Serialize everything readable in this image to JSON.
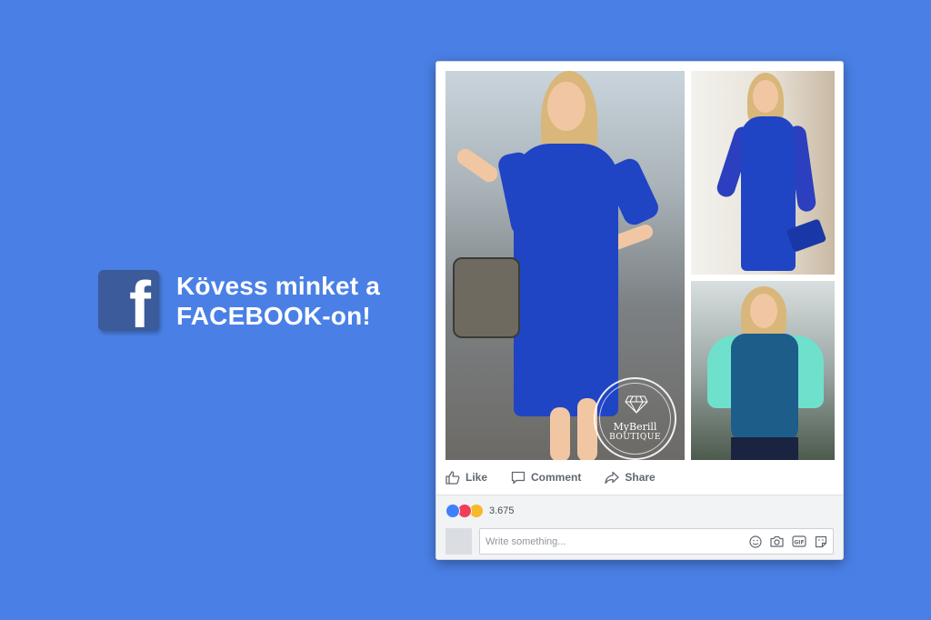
{
  "promo": {
    "line1": "Kövess minket a",
    "line2": "FACEBOOK-on!",
    "logo_icon": "facebook-f-icon"
  },
  "post": {
    "watermark": {
      "line1": "MyBerill",
      "line2": "BOUTIQUE"
    },
    "actions": [
      {
        "label": "Like",
        "icon": "thumbs-up-icon"
      },
      {
        "label": "Comment",
        "icon": "comment-icon"
      },
      {
        "label": "Share",
        "icon": "share-icon"
      }
    ],
    "reaction_count": "3.675",
    "composer": {
      "placeholder": "Write something...",
      "icons": [
        "emoji-icon",
        "camera-icon",
        "gif-icon",
        "sticker-icon"
      ]
    }
  },
  "colors": {
    "background": "#4a80e6",
    "facebook_blue": "#3b5b9a",
    "dress_blue": "#1f45c4"
  }
}
